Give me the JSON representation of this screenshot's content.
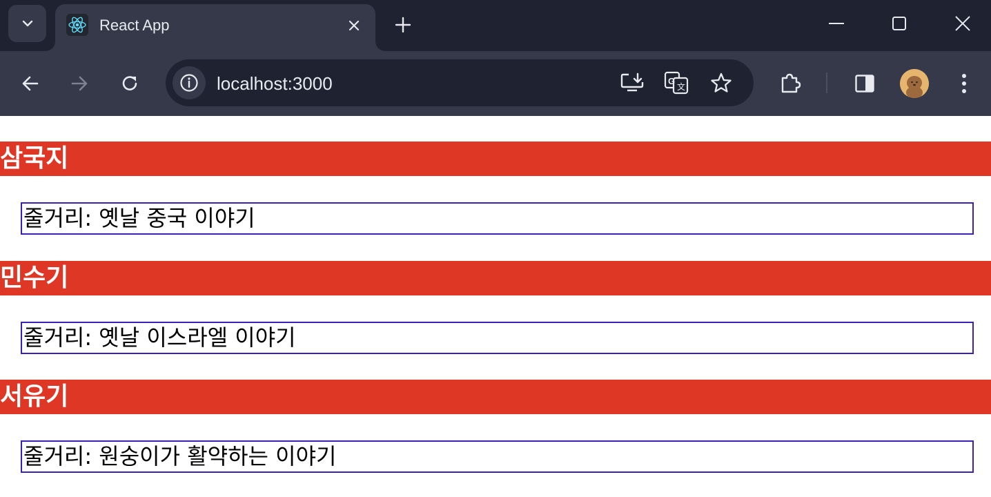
{
  "browser": {
    "tab_title": "React App",
    "url": "localhost:3000"
  },
  "colors": {
    "title_bar_red": "#df3725",
    "desc_border": "#3a1fb8",
    "chrome_dark": "#1f2230",
    "chrome_mid": "#35394a"
  },
  "icons": {
    "tab_search": "chevron-down-icon",
    "favicon": "react-icon",
    "tab_close": "close-icon",
    "new_tab": "plus-icon",
    "minimize": "minimize-icon",
    "maximize": "maximize-icon",
    "close_window": "close-icon",
    "back": "back-arrow-icon",
    "forward": "forward-arrow-icon",
    "reload": "reload-icon",
    "site_info": "info-icon",
    "install": "install-app-icon",
    "translate": "translate-icon",
    "bookmark": "star-icon",
    "extensions": "puzzle-icon",
    "side_panel": "side-panel-icon",
    "profile": "avatar",
    "menu": "kebab-menu-icon"
  },
  "books": [
    {
      "title": "삼국지",
      "description": "줄거리: 옛날 중국 이야기"
    },
    {
      "title": "민수기",
      "description": "줄거리: 옛날 이스라엘 이야기"
    },
    {
      "title": "서유기",
      "description": "줄거리: 원숭이가 활약하는 이야기"
    }
  ]
}
